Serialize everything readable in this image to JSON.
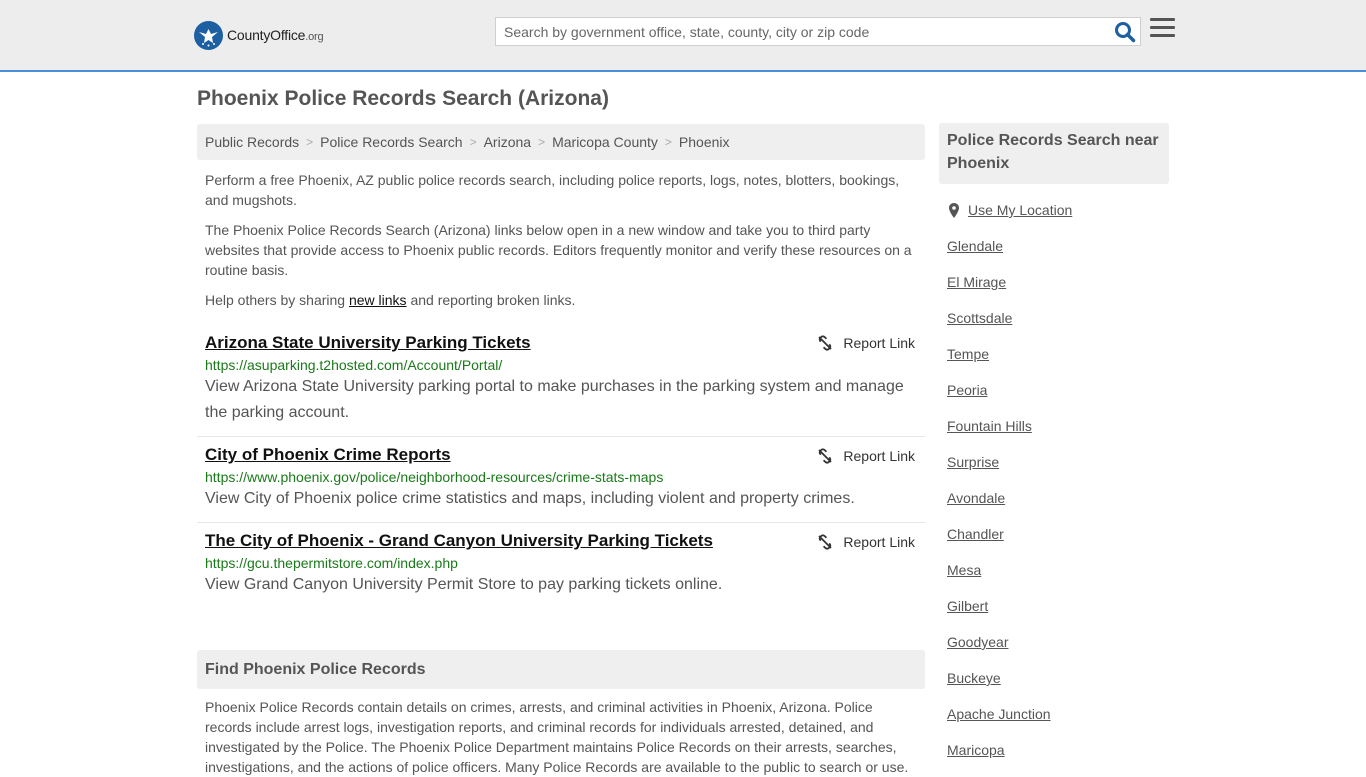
{
  "header": {
    "logo_name": "CountyOffice",
    "logo_tld": ".org",
    "search_placeholder": "Search by government office, state, county, city or zip code"
  },
  "page": {
    "title": "Phoenix Police Records Search (Arizona)"
  },
  "breadcrumb": [
    "Public Records",
    "Police Records Search",
    "Arizona",
    "Maricopa County",
    "Phoenix"
  ],
  "intro": {
    "p1": "Perform a free Phoenix, AZ public police records search, including police reports, logs, notes, blotters, bookings, and mugshots.",
    "p2": "The Phoenix Police Records Search (Arizona) links below open in a new window and take you to third party websites that provide access to Phoenix public records. Editors frequently monitor and verify these resources on a routine basis.",
    "p3_before": "Help others by sharing ",
    "p3_link": "new links",
    "p3_after": " and reporting broken links."
  },
  "report_label": "Report Link",
  "results": [
    {
      "title": "Arizona State University Parking Tickets",
      "url": "https://asuparking.t2hosted.com/Account/Portal/",
      "desc": "View Arizona State University parking portal to make purchases in the parking system and manage the parking account."
    },
    {
      "title": "City of Phoenix Crime Reports",
      "url": "https://www.phoenix.gov/police/neighborhood-resources/crime-stats-maps",
      "desc": "View City of Phoenix police crime statistics and maps, including violent and property crimes."
    },
    {
      "title": "The City of Phoenix - Grand Canyon University Parking Tickets",
      "url": "https://gcu.thepermitstore.com/index.php",
      "desc": "View Grand Canyon University Permit Store to pay parking tickets online."
    }
  ],
  "find": {
    "heading": "Find Phoenix Police Records",
    "body": "Phoenix Police Records contain details on crimes, arrests, and criminal activities in Phoenix, Arizona. Police records include arrest logs, investigation reports, and criminal records for individuals arrested, detained, and investigated by the Police. The Phoenix Police Department maintains Police Records on their arrests, searches, investigations, and the actions of police officers. Many Police Records are available to the public to search or use."
  },
  "sidebar": {
    "heading": "Police Records Search near Phoenix",
    "use_location": "Use My Location",
    "cities": [
      "Glendale",
      "El Mirage",
      "Scottsdale",
      "Tempe",
      "Peoria",
      "Fountain Hills",
      "Surprise",
      "Avondale",
      "Chandler",
      "Mesa",
      "Gilbert",
      "Goodyear",
      "Buckeye",
      "Apache Junction",
      "Maricopa"
    ]
  },
  "colors": {
    "header_bg": "#ededed",
    "accent_border": "#4a90d9",
    "url_green": "#1a7a1a",
    "logo_blue": "#1d5fa0",
    "search_icon_blue": "#1d5fa0"
  }
}
